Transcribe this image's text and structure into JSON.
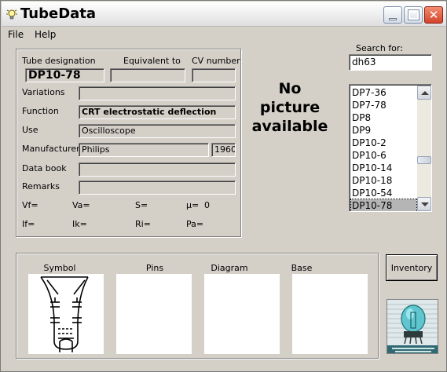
{
  "window": {
    "title": "TubeData"
  },
  "menu": {
    "file": "File",
    "help": "Help"
  },
  "headers": {
    "designation": "Tube designation",
    "equivalent": "Equivalent to",
    "cv": "CV number"
  },
  "tube": {
    "designation": "DP10-78",
    "equivalent": "",
    "cv_number": "",
    "variations": "",
    "function": "CRT electrostatic deflection",
    "use": "Oscilloscope",
    "manufacturer": "Philips",
    "year": "1960",
    "data_book": "",
    "remarks": ""
  },
  "labels": {
    "variations": "Variations",
    "function": "Function",
    "use": "Use",
    "manufacturer": "Manufacturer",
    "data_book": "Data book",
    "remarks": "Remarks"
  },
  "params": {
    "vf": "Vf=",
    "va": "Va=",
    "s": "S=",
    "mu": "µ=",
    "mu_value": "0",
    "if": "If=",
    "ik": "Ik=",
    "ri": "Ri=",
    "pa": "Pa="
  },
  "picture": {
    "line1": "No",
    "line2": "picture",
    "line3": "available"
  },
  "search": {
    "label": "Search for:",
    "value": "dh63"
  },
  "list": {
    "items": [
      "DP7-36",
      "DP7-78",
      "DP8",
      "DP9",
      "DP10-2",
      "DP10-6",
      "DP10-14",
      "DP10-18",
      "DP10-54",
      "DP10-78"
    ],
    "selected": "DP10-78"
  },
  "panels": {
    "symbol": "Symbol",
    "pins": "Pins",
    "diagram": "Diagram",
    "base": "Base"
  },
  "buttons": {
    "inventory": "Inventory"
  },
  "icons": {
    "app": "lightbulb-icon",
    "minimize": "minimize-icon",
    "maximize": "maximize-icon",
    "close": "close-icon",
    "scroll_up": "chevron-up-icon",
    "scroll_down": "chevron-down-icon",
    "logo": "tube-logo-icon"
  }
}
